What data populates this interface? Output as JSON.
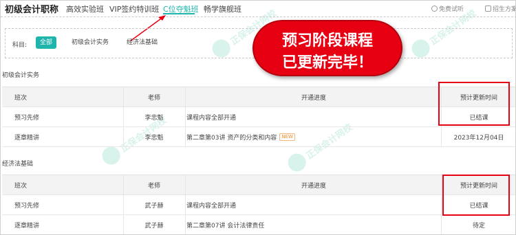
{
  "header": {
    "title": "初级会计职称",
    "tabs": [
      {
        "label": "高效实验班"
      },
      {
        "label": "VIP签约特训班"
      },
      {
        "label": "C位夺魁班"
      },
      {
        "label": "畅学旗舰班"
      }
    ],
    "active_tab": "C位夺魁班",
    "right_links": [
      {
        "label": "免费试听",
        "icon": "play-icon"
      },
      {
        "label": "招生方案",
        "icon": "document-icon"
      }
    ]
  },
  "subject_filter": {
    "label": "科目:",
    "options": [
      {
        "label": "全部"
      },
      {
        "label": "初级会计实务"
      },
      {
        "label": "经济法基础"
      }
    ],
    "selected": "全部"
  },
  "sections": [
    {
      "title": "初级会计实务",
      "columns": [
        "班次",
        "老师",
        "开通进度",
        "预计更新时间"
      ],
      "rows": [
        {
          "class": "预习先修",
          "teacher": "李忠魁",
          "progress": "课程内容全部开通",
          "badge": "",
          "update": "已结课"
        },
        {
          "class": "逐章精讲",
          "teacher": "李忠魁",
          "progress": "第二章第03讲   资产的分类和内容",
          "badge": "NEW",
          "update": "2023年12月04日"
        }
      ]
    },
    {
      "title": "经济法基础",
      "columns": [
        "班次",
        "老师",
        "开通进度",
        "预计更新时间"
      ],
      "rows": [
        {
          "class": "预习先修",
          "teacher": "武子赫",
          "progress": "课程内容全部开通",
          "badge": "",
          "update": "已结课"
        },
        {
          "class": "逐章精讲",
          "teacher": "武子赫",
          "progress": "第二章第07讲   会计法律责任",
          "badge": "",
          "update": "待定"
        }
      ]
    }
  ],
  "callout": {
    "line1": "预习阶段课程",
    "line2": "已更新完毕！"
  },
  "watermark": {
    "brand": "正保会计网校",
    "url": "www.chinaacc.com"
  },
  "colors": {
    "accent": "#1fb5ad",
    "highlight_red": "#e60012",
    "badge_orange": "#f08a24"
  }
}
